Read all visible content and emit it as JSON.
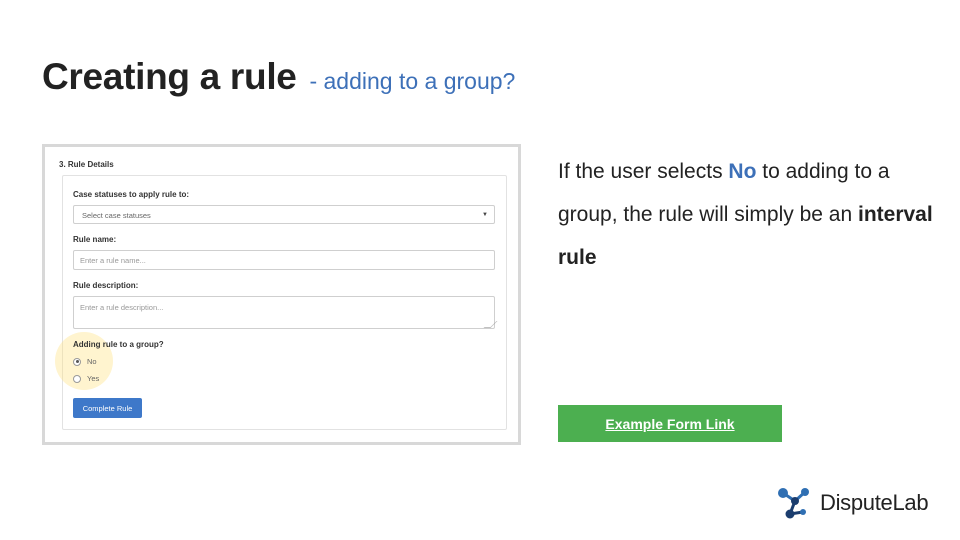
{
  "slide": {
    "title_main": "Creating a rule",
    "title_sub": "- adding to a group?"
  },
  "form": {
    "section_title": "3. Rule Details",
    "case_statuses_label": "Case statuses to apply rule to:",
    "case_statuses_value": "Select case statuses",
    "rule_name_label": "Rule name:",
    "rule_name_placeholder": "Enter a rule name...",
    "rule_description_label": "Rule description:",
    "rule_description_placeholder": "Enter a rule description...",
    "group_question": "Adding rule to a group?",
    "options": [
      {
        "label": "No",
        "selected": true
      },
      {
        "label": "Yes",
        "selected": false
      }
    ],
    "submit_label": "Complete Rule"
  },
  "explanation": {
    "part1": "If the user selects ",
    "no_word": "No",
    "part2": " to adding to a group, the rule will simply be an ",
    "bold_term": "interval rule"
  },
  "link_button": {
    "label": "Example Form Link",
    "color": "#4caf50"
  },
  "brand": {
    "name": "DisputeLab",
    "icon": "molecule-logo-icon",
    "colors": [
      "#2f6fb3",
      "#1b3d6e"
    ]
  },
  "colors": {
    "accent_blue": "#3d70b8",
    "button_blue": "#3e78c9"
  }
}
